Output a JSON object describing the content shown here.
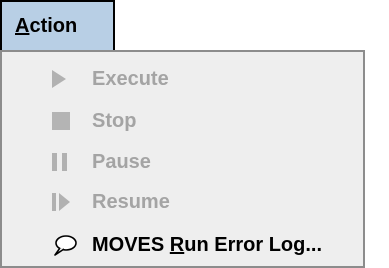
{
  "menu": {
    "title": "Action",
    "title_mnemonic": "A",
    "title_rest": "ction",
    "items": [
      {
        "label": "Execute",
        "icon": "play-icon",
        "enabled": false
      },
      {
        "label": "Stop",
        "icon": "stop-icon",
        "enabled": false
      },
      {
        "label": "Pause",
        "icon": "pause-icon",
        "enabled": false
      },
      {
        "label": "Resume",
        "icon": "resume-icon",
        "enabled": false
      },
      {
        "label": "MOVES Run Error Log...",
        "label_prefix": "MOVES ",
        "label_mnemonic": "R",
        "label_suffix": "un Error Log...",
        "icon": "speech-bubble-icon",
        "enabled": true
      }
    ]
  },
  "colors": {
    "menubar_selected": "#b8cfe5",
    "dropdown_bg": "#eeeeee",
    "disabled_text": "#a4a4a4",
    "enabled_text": "#000000"
  }
}
